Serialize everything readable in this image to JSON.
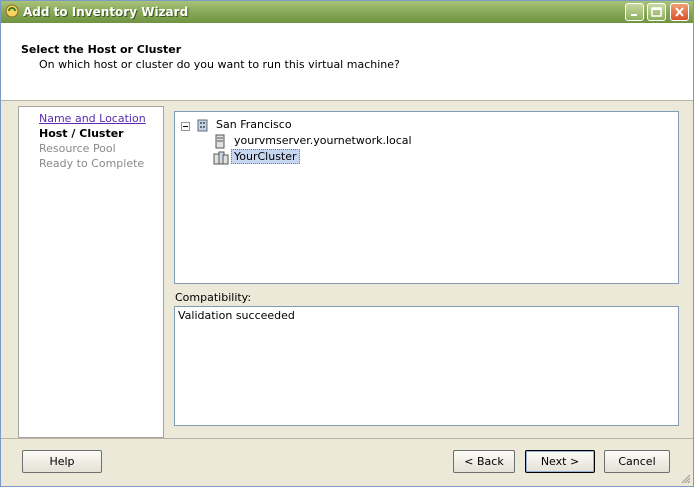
{
  "window": {
    "title": "Add to Inventory Wizard"
  },
  "header": {
    "title": "Select the Host or Cluster",
    "subtitle": "On which host or cluster do you want to run this virtual machine?"
  },
  "nav": {
    "steps": [
      {
        "label": "Name and Location",
        "state": "link"
      },
      {
        "label": "Host / Cluster",
        "state": "current"
      },
      {
        "label": "Resource Pool",
        "state": "disabled"
      },
      {
        "label": "Ready to Complete",
        "state": "disabled"
      }
    ]
  },
  "tree": {
    "datacenter": {
      "label": "San Francisco",
      "icon": "datacenter-icon"
    },
    "host": {
      "label": "yourvmserver.yournetwork.local",
      "icon": "host-server-icon"
    },
    "cluster": {
      "label": "YourCluster",
      "icon": "cluster-icon",
      "selected": true
    }
  },
  "compatibility": {
    "label": "Compatibility:",
    "message": "Validation succeeded"
  },
  "footer": {
    "help_label": "Help",
    "back_label": "< Back",
    "next_label": "Next >",
    "cancel_label": "Cancel"
  },
  "colors": {
    "titlebar": "#8aab5a",
    "selection": "#c7d7f1",
    "link": "#5a2bb0"
  }
}
